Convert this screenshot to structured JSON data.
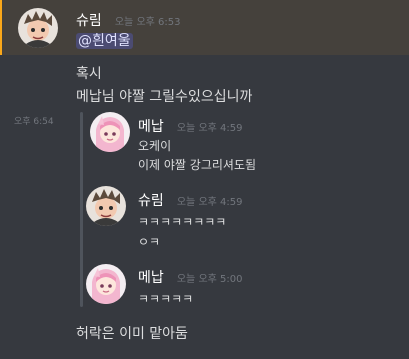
{
  "messages": {
    "m1": {
      "author": "슈림",
      "time": "오늘 오후 6:53",
      "lines": [
        "@흰여울",
        "혹시",
        "메납님 야짤 그릴수있으십니까"
      ]
    },
    "m2": {
      "side_time": "오후 6:54",
      "quotes": [
        {
          "author": "메납",
          "time": "오늘 오후 4:59",
          "lines": [
            "오케이",
            "이제 야짤 강그리셔도됨"
          ]
        },
        {
          "author": "슈림",
          "time": "오늘 오후 4:59",
          "lines": [
            "ㅋㅋㅋㅋㅋㅋㅋㅋ",
            "ㅇㅋ"
          ]
        },
        {
          "author": "메납",
          "time": "오늘 오후 5:00",
          "lines": [
            "ㅋㅋㅋㅋㅋ"
          ]
        }
      ],
      "last_line": "허락은 이미 맡아둠"
    }
  },
  "colors": {
    "background": "#36393f",
    "mention_bar": "#faa81a",
    "text": "#dcddde",
    "muted": "#72767d"
  }
}
